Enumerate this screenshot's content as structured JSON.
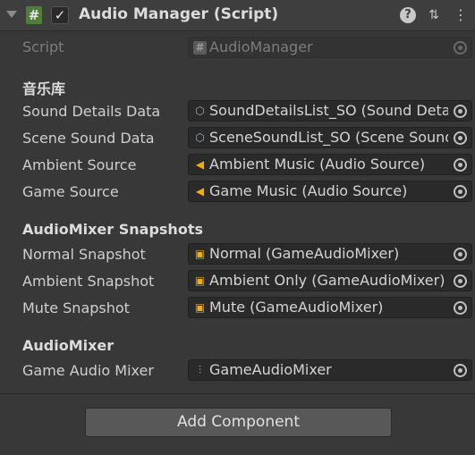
{
  "component": {
    "title": "Audio Manager (Script)",
    "script_icon": "#",
    "enabled_check": "✓",
    "help_icon": "?",
    "preset_icon": "⇅",
    "menu_icon": "⋮"
  },
  "script_field": {
    "label": "Script",
    "value": "AudioManager",
    "icon": "script-asset-icon",
    "disabled": true
  },
  "sections": {
    "music_lib": "音乐库",
    "snapshots": "AudioMixer Snapshots",
    "mixer": "AudioMixer"
  },
  "fields": {
    "sound_details": {
      "label": "Sound Details Data",
      "value": "SoundDetailsList_SO (Sound Details List_SO)",
      "icon": "scriptable-object-icon"
    },
    "scene_sound": {
      "label": "Scene Sound Data",
      "value": "SceneSoundList_SO (Scene Sound List_SO)",
      "icon": "scriptable-object-icon"
    },
    "ambient_source": {
      "label": "Ambient Source",
      "value": "Ambient Music (Audio Source)",
      "icon": "audio-source-icon"
    },
    "game_source": {
      "label": "Game Source",
      "value": "Game Music (Audio Source)",
      "icon": "audio-source-icon"
    },
    "normal_snapshot": {
      "label": "Normal Snapshot",
      "value": "Normal (GameAudioMixer)",
      "icon": "snapshot-icon"
    },
    "ambient_snapshot": {
      "label": "Ambient Snapshot",
      "value": "Ambient Only (GameAudioMixer)",
      "icon": "snapshot-icon"
    },
    "mute_snapshot": {
      "label": "Mute Snapshot",
      "value": "Mute (GameAudioMixer)",
      "icon": "snapshot-icon"
    },
    "game_mixer": {
      "label": "Game Audio Mixer",
      "value": "GameAudioMixer",
      "icon": "audio-mixer-icon"
    }
  },
  "add_component": "Add Component",
  "colors": {
    "background": "#383838",
    "header": "#3e3e3e",
    "field": "#2a2a2a",
    "button": "#585858",
    "audio_accent": "#f0b000"
  }
}
